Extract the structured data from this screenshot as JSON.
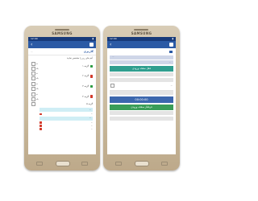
{
  "phone_brand": "SAMSUNG",
  "left": {
    "status_time": "12:00",
    "breadcrumb_mini": "...",
    "screen_title": "کاربری",
    "description": "آیتم های زیر را مشخص نمایید",
    "rows": [
      {
        "label": "گزینه ۱",
        "opt_a": "نه",
        "opt_b": "بله"
      },
      {
        "label": "گزینه ۲",
        "opt_a": "نه",
        "opt_b": "بله"
      },
      {
        "label": "گزینه ۳",
        "opt_a": "نه",
        "opt_b": "بله"
      },
      {
        "label": "گزینه ۴",
        "opt_a": "نه",
        "opt_b": "بله"
      }
    ],
    "extra_label": "گزینه ۵",
    "cyan_rows": [
      "...",
      "..."
    ],
    "sub_rows": [
      "...",
      "...",
      "...",
      "..."
    ]
  },
  "right": {
    "status_time": "12:00",
    "fields": [
      "...",
      "..."
    ],
    "bands": [
      "قفل صفحه ورودی",
      "...",
      "قرفلتار صفحه ورودی"
    ],
    "row_label": "...",
    "timer": "00:00:00"
  },
  "colors": {
    "appbar": "#2b5aa5",
    "statusbar": "#173a7a",
    "accent_green": "#2f9e44",
    "accent_red": "#d33b2c",
    "cyan": "#cfeef5"
  }
}
